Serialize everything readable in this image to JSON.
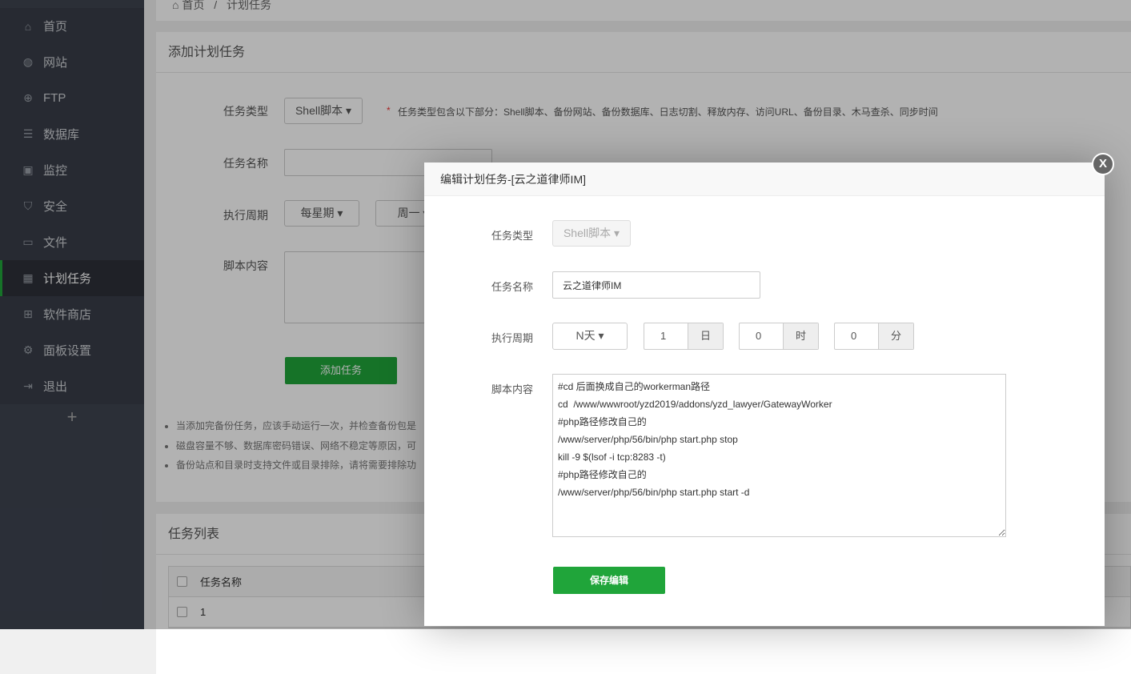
{
  "sidebar": {
    "items": [
      {
        "label": "首页",
        "icon": "home-icon",
        "glyph": "⌂"
      },
      {
        "label": "网站",
        "icon": "globe-icon",
        "glyph": "◍"
      },
      {
        "label": "FTP",
        "icon": "ftp-icon",
        "glyph": "⊕"
      },
      {
        "label": "数据库",
        "icon": "database-icon",
        "glyph": "☰"
      },
      {
        "label": "监控",
        "icon": "monitor-icon",
        "glyph": "▣"
      },
      {
        "label": "安全",
        "icon": "shield-icon",
        "glyph": "⛉"
      },
      {
        "label": "文件",
        "icon": "folder-icon",
        "glyph": "▭"
      },
      {
        "label": "计划任务",
        "icon": "calendar-icon",
        "glyph": "▦",
        "active": true
      },
      {
        "label": "软件商店",
        "icon": "apps-icon",
        "glyph": "⊞"
      },
      {
        "label": "面板设置",
        "icon": "gear-icon",
        "glyph": "⚙"
      },
      {
        "label": "退出",
        "icon": "logout-icon",
        "glyph": "⇥"
      }
    ],
    "add": "+"
  },
  "breadcrumb": {
    "home": "首页",
    "sep": "/",
    "current": "计划任务"
  },
  "add_panel": {
    "title": "添加计划任务",
    "type_label": "任务类型",
    "type_value": "Shell脚本",
    "type_hint_star": "*",
    "type_hint": "任务类型包含以下部分：Shell脚本、备份网站、备份数据库、日志切割、释放内存、访问URL、备份目录、木马查杀、同步时间",
    "name_label": "任务名称",
    "cycle_label": "执行周期",
    "cycle_value": "每星期",
    "weekday_value": "周一",
    "script_label": "脚本内容",
    "add_button": "添加任务",
    "notes": [
      "当添加完备份任务，应该手动运行一次，并检查备份包是",
      "磁盘容量不够、数据库密码错误、网络不稳定等原因，可",
      "备份站点和目录时支持文件或目录排除，请将需要排除功"
    ]
  },
  "list_panel": {
    "title": "任务列表",
    "header": "任务名称",
    "rows": [
      "1"
    ]
  },
  "modal": {
    "title": "编辑计划任务-[云之道律师IM]",
    "type_label": "任务类型",
    "type_value": "Shell脚本",
    "name_label": "任务名称",
    "name_value": "云之道律师IM",
    "cycle_label": "执行周期",
    "cycle_value": "N天",
    "day_value": "1",
    "day_unit": "日",
    "hour_value": "0",
    "hour_unit": "时",
    "minute_value": "0",
    "minute_unit": "分",
    "script_label": "脚本内容",
    "script": "#cd 后面换成自己的workerman路径\ncd  /www/wwwroot/yzd2019/addons/yzd_lawyer/GatewayWorker\n#php路径修改自己的\n/www/server/php/56/bin/php start.php stop\nkill -9 $(lsof -i tcp:8283 -t)\n#php路径修改自己的\n/www/server/php/56/bin/php start.php start -d",
    "save_button": "保存编辑",
    "close": "X"
  },
  "colors": {
    "accent": "#20a53a"
  }
}
